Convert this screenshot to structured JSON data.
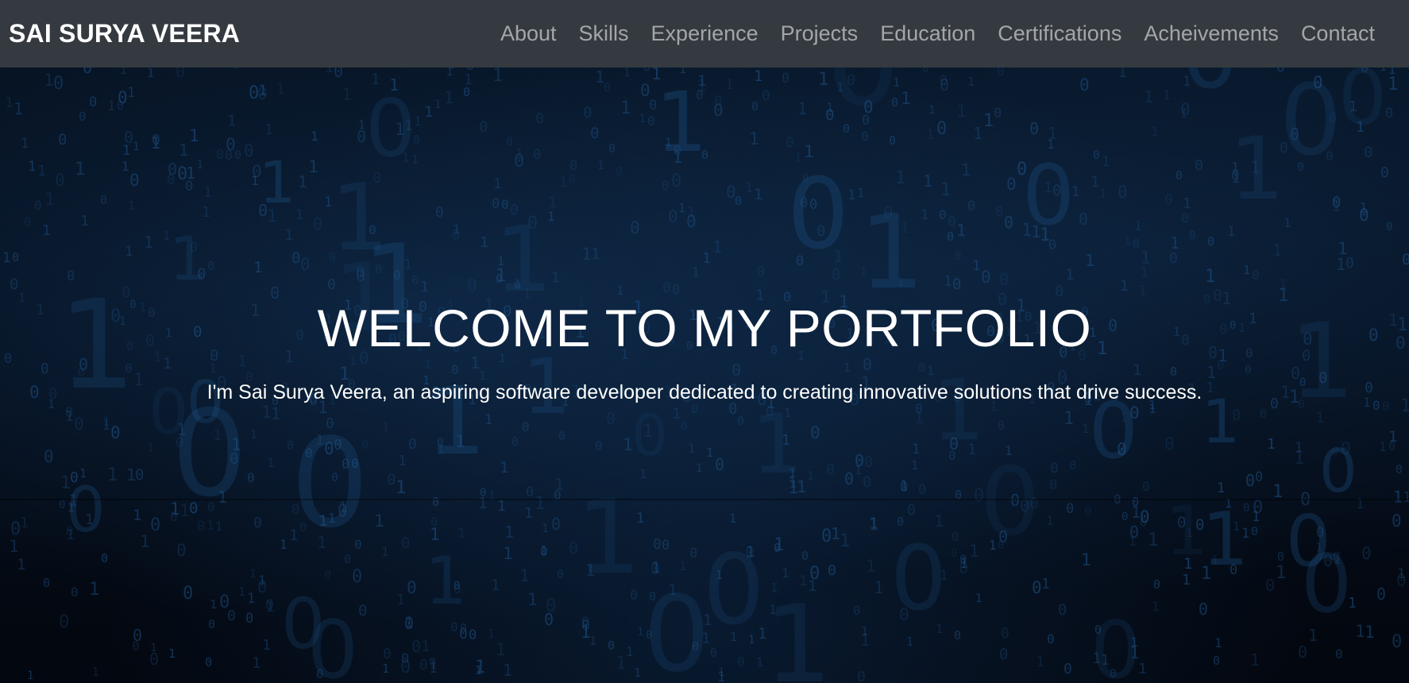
{
  "brand": "SAI SURYA VEERA",
  "nav": [
    {
      "label": "About"
    },
    {
      "label": "Skills"
    },
    {
      "label": "Experience"
    },
    {
      "label": "Projects"
    },
    {
      "label": "Education"
    },
    {
      "label": "Certifications"
    },
    {
      "label": "Acheivements"
    },
    {
      "label": "Contact"
    }
  ],
  "hero": {
    "title": "WELCOME TO MY PORTFOLIO",
    "subtitle": "I'm Sai Surya Veera, an aspiring software developer dedicated to creating innovative solutions that drive success.",
    "background": "binary-code-background"
  },
  "colors": {
    "navbar": "#343a40",
    "nav_link": "rgba(255,255,255,0.55)",
    "brand": "#ffffff",
    "hero_bg": "#040b16",
    "binary_glyph": "#1b4a7a"
  }
}
